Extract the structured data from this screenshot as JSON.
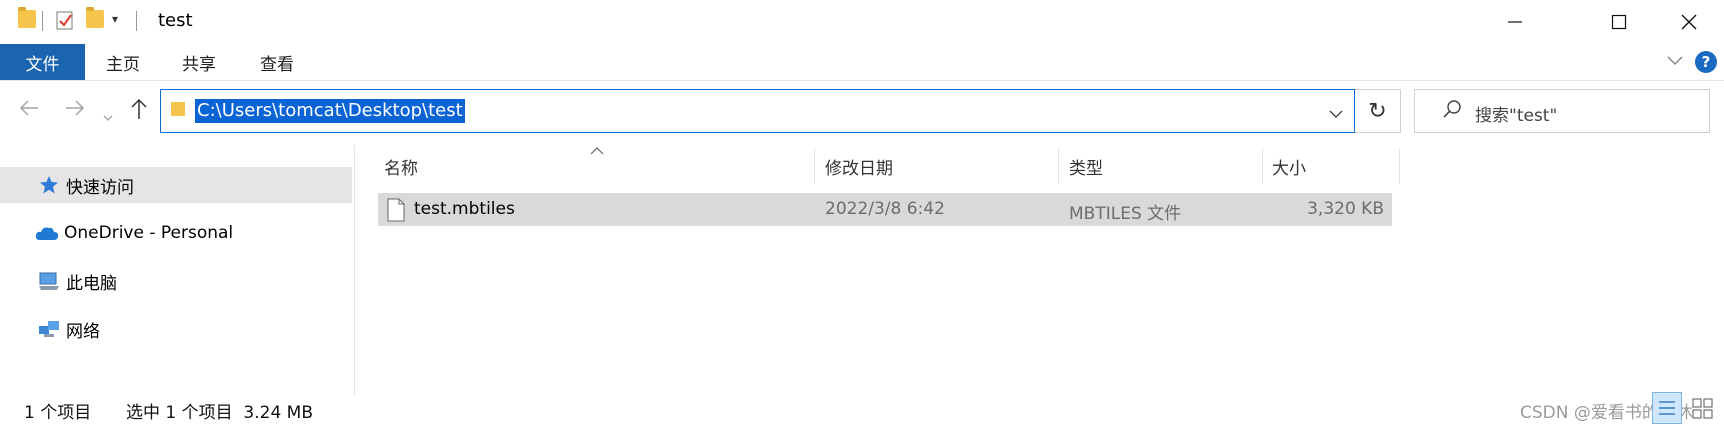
{
  "window": {
    "title": "test"
  },
  "ribbon": {
    "tabs": [
      "文件",
      "主页",
      "共享",
      "查看"
    ]
  },
  "address": {
    "path": "C:\\Users\\tomcat\\Desktop\\test"
  },
  "search": {
    "placeholder": "搜索\"test\""
  },
  "nav_pane": {
    "items": [
      {
        "label": "快速访问",
        "icon": "quick-access-star-icon",
        "selected": true
      },
      {
        "label": "OneDrive - Personal",
        "icon": "onedrive-cloud-icon",
        "selected": false
      },
      {
        "label": "此电脑",
        "icon": "this-pc-icon",
        "selected": false
      },
      {
        "label": "网络",
        "icon": "network-icon",
        "selected": false
      }
    ]
  },
  "file_list": {
    "columns": [
      "名称",
      "修改日期",
      "类型",
      "大小"
    ],
    "rows": [
      {
        "name": "test.mbtiles",
        "modified": "2022/3/8 6:42",
        "type": "MBTILES 文件",
        "size": "3,320 KB",
        "selected": true
      }
    ]
  },
  "status_bar": {
    "item_count": "1 个项目",
    "selection": "选中 1 个项目  3.24 MB"
  },
  "watermark": "CSDN @爱看书的小沐",
  "colors": {
    "accent": "#1a64b0",
    "selection": "#0a64d6",
    "row_selected": "#d9d9d9",
    "folder": "#f5c44a"
  }
}
